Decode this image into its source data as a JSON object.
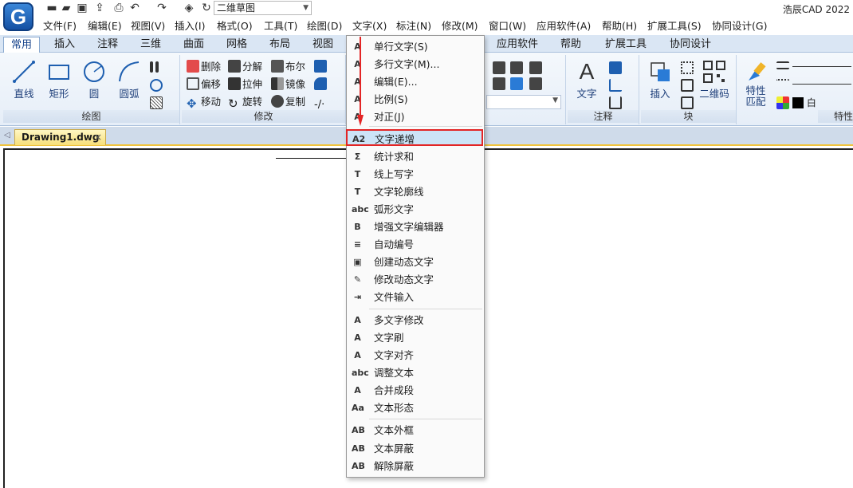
{
  "app": {
    "title": "浩辰CAD 2022",
    "logo": "G",
    "workspace": "二维草图"
  },
  "quick_access": [
    {
      "icon": "new-file-icon",
      "glyph": "▬"
    },
    {
      "icon": "open-folder-icon",
      "glyph": "▰"
    },
    {
      "icon": "save-icon",
      "glyph": "▣"
    },
    {
      "icon": "save-as-icon",
      "glyph": "⇪"
    },
    {
      "icon": "print-icon",
      "glyph": "⎙"
    },
    {
      "icon": "undo-icon",
      "glyph": "↶"
    },
    {
      "icon": "redo-icon",
      "glyph": "↷"
    },
    {
      "icon": "layers-icon",
      "glyph": "◈"
    },
    {
      "icon": "refresh-icon",
      "glyph": "↻"
    }
  ],
  "menubar": [
    "文件(F)",
    "编辑(E)",
    "视图(V)",
    "插入(I)",
    "格式(O)",
    "工具(T)",
    "绘图(D)",
    "文字(X)",
    "标注(N)",
    "修改(M)",
    "窗口(W)",
    "应用软件(A)",
    "帮助(H)",
    "扩展工具(S)",
    "协同设计(G)"
  ],
  "ribbon_tabs": [
    "常用",
    "插入",
    "注释",
    "三维",
    "曲面",
    "网格",
    "布局",
    "视图",
    "应用软件",
    "帮助",
    "扩展工具",
    "协同设计"
  ],
  "ribbon": {
    "draw": {
      "label": "绘图",
      "line": "直线",
      "rect": "矩形",
      "circle": "圆",
      "arc": "圆弧"
    },
    "modify": {
      "label": "修改",
      "erase": "删除",
      "explode": "分解",
      "boolean": "布尔",
      "offset": "偏移",
      "stretch": "拉伸",
      "mirror": "镜像",
      "move": "移动",
      "rotate": "旋转",
      "copy": "复制"
    },
    "annotate": {
      "label": "注释",
      "text": "文字"
    },
    "block": {
      "label": "块",
      "insert": "插入",
      "qrcode": "二维码"
    },
    "properties": {
      "label": "特性",
      "match": "特性\n匹配",
      "match_line1": "特性",
      "match_line2": "匹配",
      "color": "白"
    }
  },
  "document": {
    "tab": "Drawing1.dwg",
    "close": "×"
  },
  "text_menu": {
    "items": [
      {
        "label": "单行文字(S)",
        "icon": "single-line-text-icon",
        "glyph": "A"
      },
      {
        "label": "多行文字(M)...",
        "icon": "multiline-text-icon",
        "glyph": "A"
      },
      {
        "label": "编辑(E)...",
        "icon": "edit-text-icon",
        "glyph": "A"
      },
      {
        "label": "比例(S)",
        "icon": "scale-text-icon",
        "glyph": "A"
      },
      {
        "label": "对正(J)",
        "icon": "justify-text-icon",
        "glyph": "A"
      },
      {
        "label": "文字递增",
        "icon": "text-increment-icon",
        "glyph": "A2"
      },
      {
        "label": "统计求和",
        "icon": "sum-icon",
        "glyph": "Σ"
      },
      {
        "label": "线上写字",
        "icon": "text-on-line-icon",
        "glyph": "T"
      },
      {
        "label": "文字轮廓线",
        "icon": "text-outline-icon",
        "glyph": "T"
      },
      {
        "label": "弧形文字",
        "icon": "arc-text-icon",
        "glyph": "abc"
      },
      {
        "label": "增强文字编辑器",
        "icon": "enhanced-editor-icon",
        "glyph": "B"
      },
      {
        "label": "自动编号",
        "icon": "auto-number-icon",
        "glyph": "≡"
      },
      {
        "label": "创建动态文字",
        "icon": "create-dynamic-text-icon",
        "glyph": "▣"
      },
      {
        "label": "修改动态文字",
        "icon": "modify-dynamic-text-icon",
        "glyph": "✎"
      },
      {
        "label": "文件输入",
        "icon": "file-input-icon",
        "glyph": "⇥"
      },
      {
        "label": "多文字修改",
        "icon": "multi-text-modify-icon",
        "glyph": "A"
      },
      {
        "label": "文字刷",
        "icon": "text-brush-icon",
        "glyph": "A"
      },
      {
        "label": "文字对齐",
        "icon": "text-align-icon",
        "glyph": "A"
      },
      {
        "label": "调整文本",
        "icon": "adjust-text-icon",
        "glyph": "abc"
      },
      {
        "label": "合并成段",
        "icon": "merge-paragraph-icon",
        "glyph": "A"
      },
      {
        "label": "文本形态",
        "icon": "text-form-icon",
        "glyph": "Aa"
      },
      {
        "label": "文本外框",
        "icon": "text-frame-icon",
        "glyph": "AB"
      },
      {
        "label": "文本屏蔽",
        "icon": "text-mask-icon",
        "glyph": "AB"
      },
      {
        "label": "解除屏蔽",
        "icon": "unmask-icon",
        "glyph": "AB"
      }
    ],
    "highlighted": "文字递增"
  },
  "colors": {
    "accent": "#1f5fb2",
    "highlight_border": "#e32525",
    "ribbon_bg": "#e6eef8",
    "doc_tab": "#f7df7a"
  }
}
